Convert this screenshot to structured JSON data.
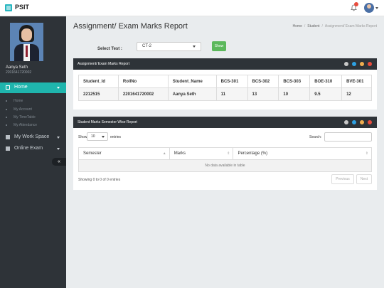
{
  "app": {
    "brand": "PSIT"
  },
  "user": {
    "name": "Aanya Seth",
    "id": "2201641720002"
  },
  "sidebar": {
    "home_label": "Home",
    "sub_items": [
      "Home",
      "My Account",
      "My TimeTable",
      "My Attendance"
    ],
    "items": [
      {
        "label": "My Work Space",
        "icon": "monitor-icon"
      },
      {
        "label": "Online Exam",
        "icon": "book-icon"
      }
    ],
    "collapse_label": "«"
  },
  "page": {
    "title": "Assignment/ Exam Marks Report",
    "breadcrumb": [
      "Home",
      "Student",
      "Assignment/ Exam Marks Report"
    ]
  },
  "select_test": {
    "label": "Select Test :",
    "value": "CT-2",
    "button": "Show"
  },
  "marks_panel": {
    "title": "Assignment/ Exam Marks Report",
    "columns": [
      "Student_Id",
      "RollNo",
      "Student_Name",
      "BCS-301",
      "BCS-302",
      "BCS-303",
      "BOE-310",
      "BVE-301"
    ],
    "rows": [
      [
        "2212515",
        "2201641720002",
        "Aanya Seth",
        "11",
        "13",
        "10",
        "9.5",
        "12"
      ]
    ]
  },
  "semester_panel": {
    "title": "Student Marks Semester Wise Report",
    "show_label": "Show",
    "entries_value": "10",
    "entries_label": "entries",
    "search_label": "Search:",
    "columns": [
      "Semester",
      "Marks",
      "Percentage (%)"
    ],
    "empty_text": "No data available in table",
    "info": "Showing 0 to 0 of 0 entries",
    "prev_label": "Previous",
    "next_label": "Next"
  },
  "colors": {
    "accent": "#1fb5ad",
    "sidebar_bg": "#2e3338",
    "panel_head": "#2e3338",
    "show_button": "#5cb85c",
    "ctrl_colors": [
      "#c8c8c8",
      "#2ea1e3",
      "#f0ad4e",
      "#e84c3d"
    ]
  }
}
